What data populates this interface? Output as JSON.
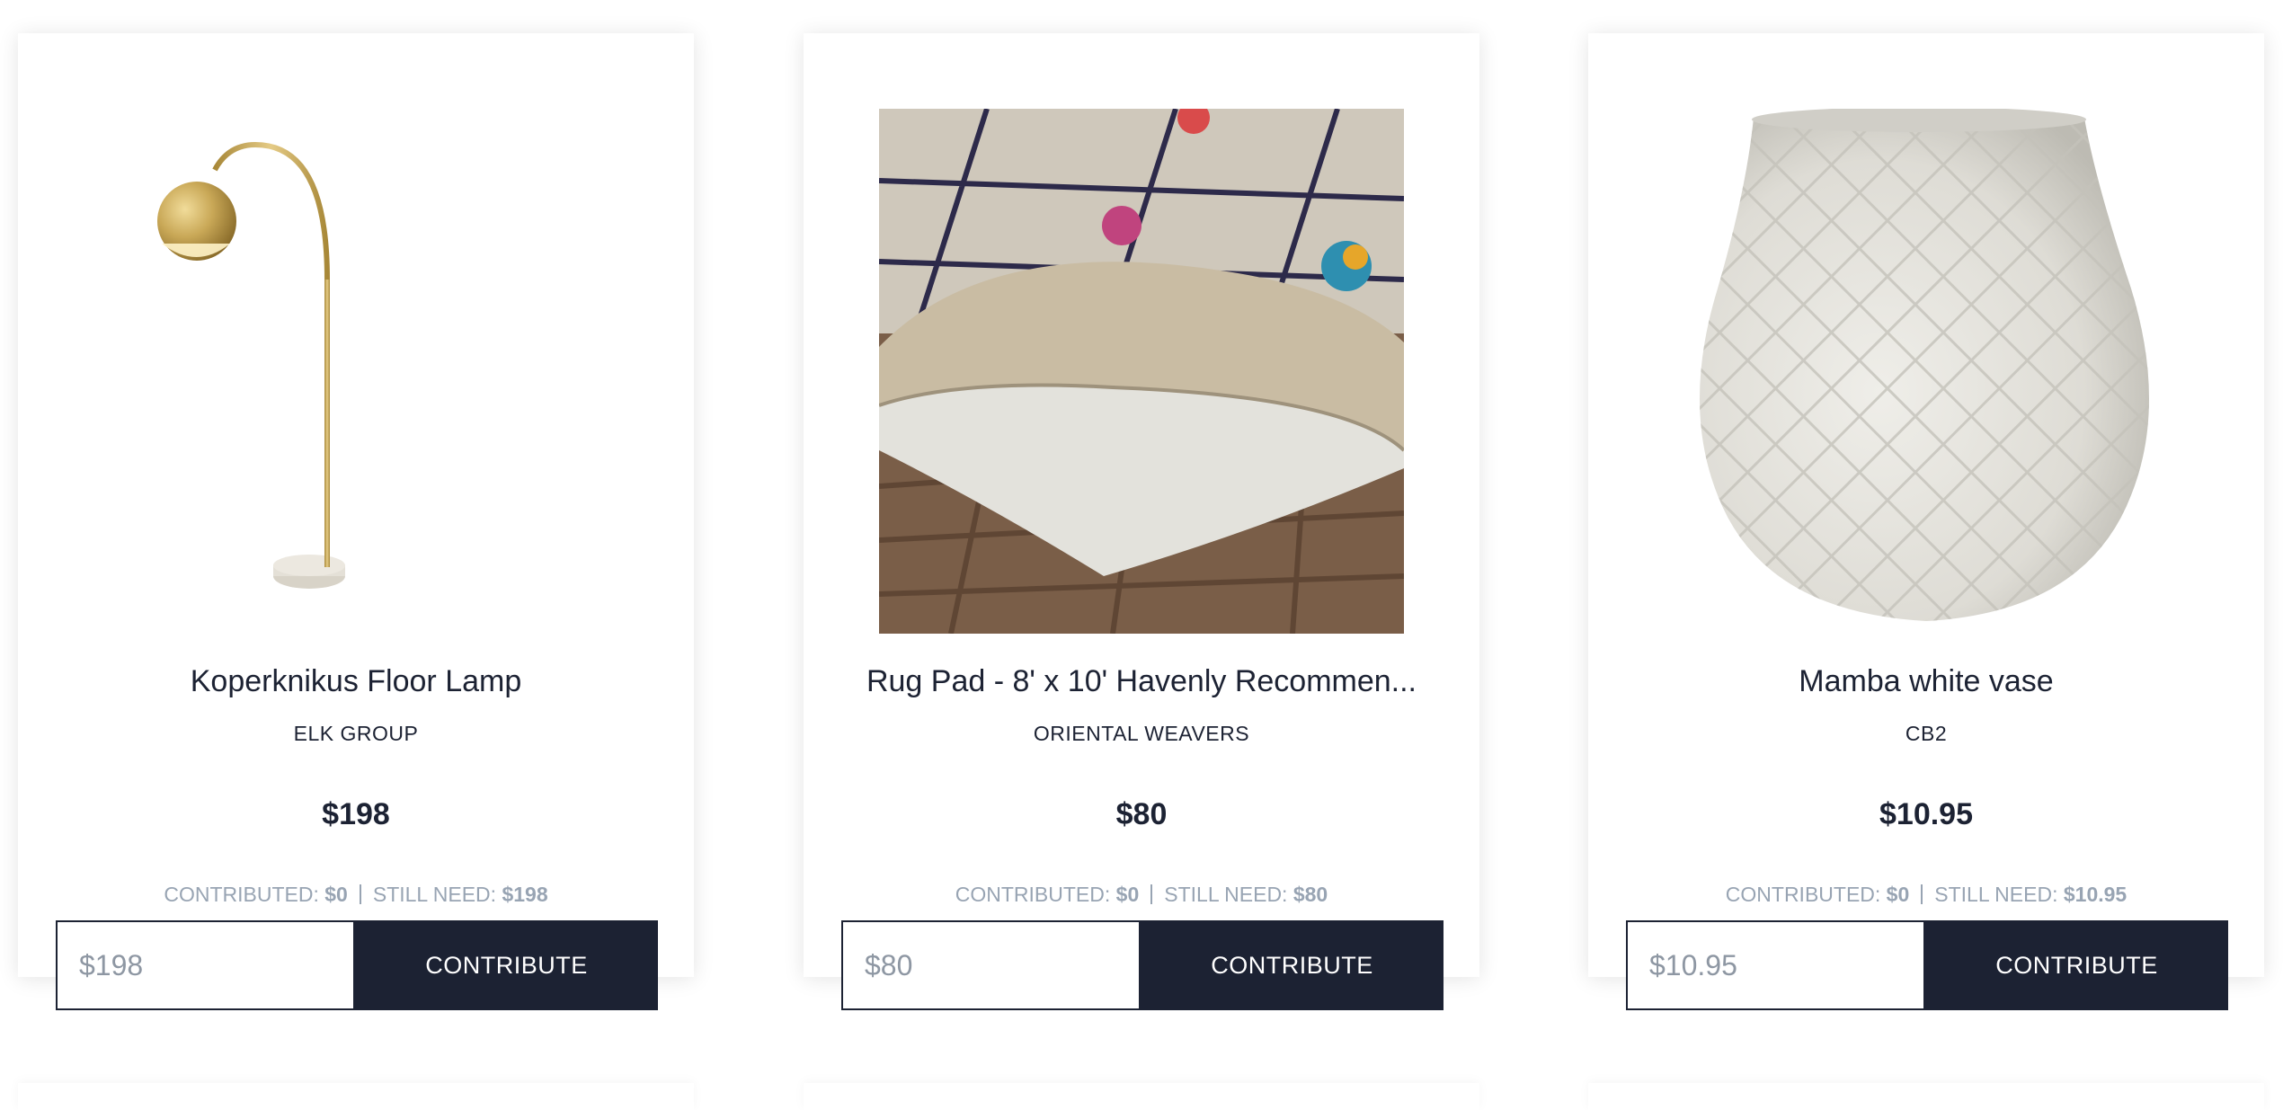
{
  "products": [
    {
      "image": "floor-lamp-image",
      "title": "Koperknikus Floor Lamp",
      "brand": "ELK GROUP",
      "price": "$198",
      "contributed_label": "CONTRIBUTED:",
      "contributed_value": "$0",
      "still_need_label": "STILL NEED:",
      "still_need_value": "$198",
      "amount_placeholder": "$198",
      "button_label": "CONTRIBUTE"
    },
    {
      "image": "rug-pad-image",
      "title": "Rug Pad - 8' x 10' Havenly Recommen...",
      "brand": "ORIENTAL WEAVERS",
      "price": "$80",
      "contributed_label": "CONTRIBUTED:",
      "contributed_value": "$0",
      "still_need_label": "STILL NEED:",
      "still_need_value": "$80",
      "amount_placeholder": "$80",
      "button_label": "CONTRIBUTE"
    },
    {
      "image": "white-vase-image",
      "title": "Mamba white vase",
      "brand": "CB2",
      "price": "$10.95",
      "contributed_label": "CONTRIBUTED:",
      "contributed_value": "$0",
      "still_need_label": "STILL NEED:",
      "still_need_value": "$10.95",
      "amount_placeholder": "$10.95",
      "button_label": "CONTRIBUTE"
    }
  ],
  "colors": {
    "navy": "#1c2233",
    "muted_text": "#98a4b3",
    "card_background": "#ffffff"
  }
}
